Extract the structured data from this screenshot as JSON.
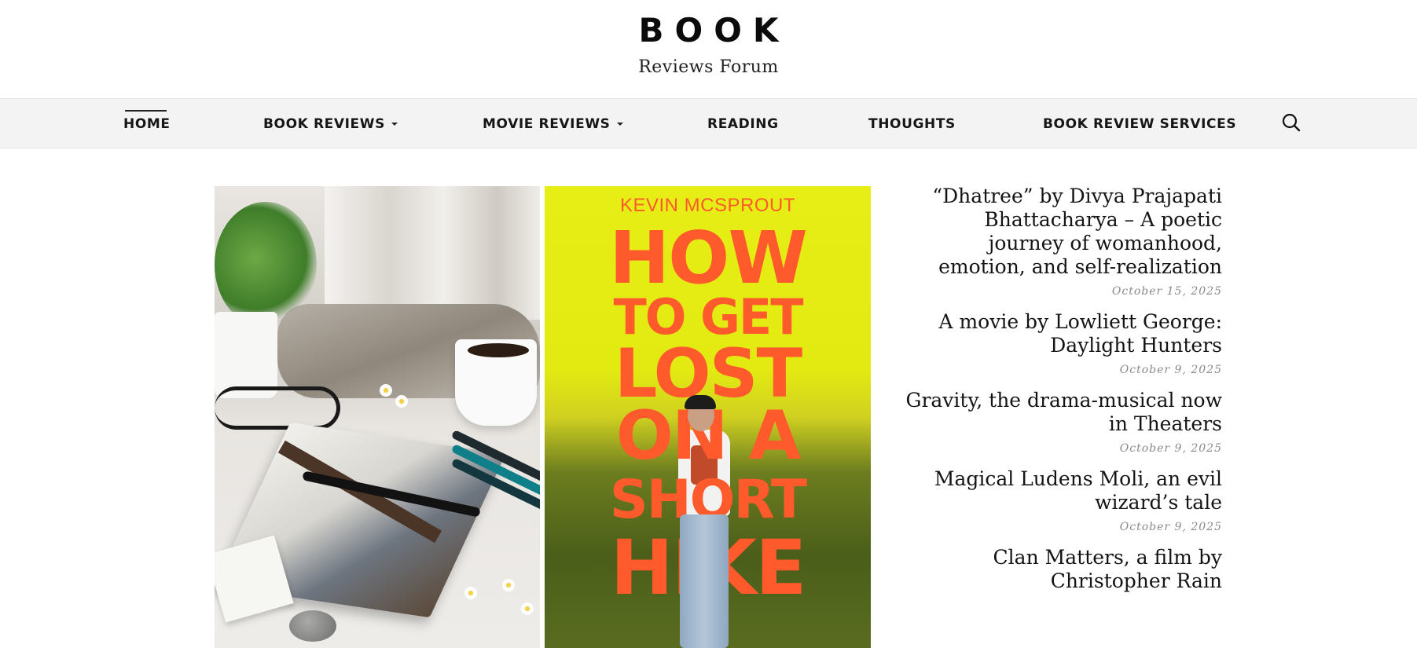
{
  "site": {
    "title": "BOOK",
    "tagline": "Reviews Forum"
  },
  "nav": {
    "items": [
      {
        "label": "HOME",
        "active": true,
        "dropdown": false
      },
      {
        "label": "BOOK REVIEWS",
        "dropdown": true
      },
      {
        "label": "MOVIE REVIEWS",
        "dropdown": true
      },
      {
        "label": "READING",
        "dropdown": false
      },
      {
        "label": "THOUGHTS",
        "dropdown": false
      },
      {
        "label": "BOOK REVIEW SERVICES",
        "dropdown": false
      }
    ],
    "search_icon": "search-icon"
  },
  "featured": {
    "cover": {
      "author": "KEVIN MCSPROUT",
      "title_lines": [
        "HOW",
        "TO GET",
        "LOST",
        "ON A",
        "SHORT",
        "HIKE"
      ]
    }
  },
  "posts": [
    {
      "title": "“Dhatree” by Divya Prajapati Bhattacharya – A poetic journey of womanhood, emotion, and self-realization",
      "date": "October 15, 2025"
    },
    {
      "title": "A movie by Lowliett George: Daylight Hunters",
      "date": "October 9, 2025"
    },
    {
      "title": "Gravity, the drama-musical now in Theaters",
      "date": "October 9, 2025"
    },
    {
      "title": "Magical Ludens Moli, an evil wizard’s tale",
      "date": "October 9, 2025"
    },
    {
      "title": "Clan Matters, a film by Christopher Rain",
      "date": ""
    }
  ],
  "colors": {
    "nav_bg": "#f3f3f3",
    "cover_bg": "#e6ee16",
    "cover_text": "#ff5a2c",
    "date_text": "#8a8a8a"
  }
}
